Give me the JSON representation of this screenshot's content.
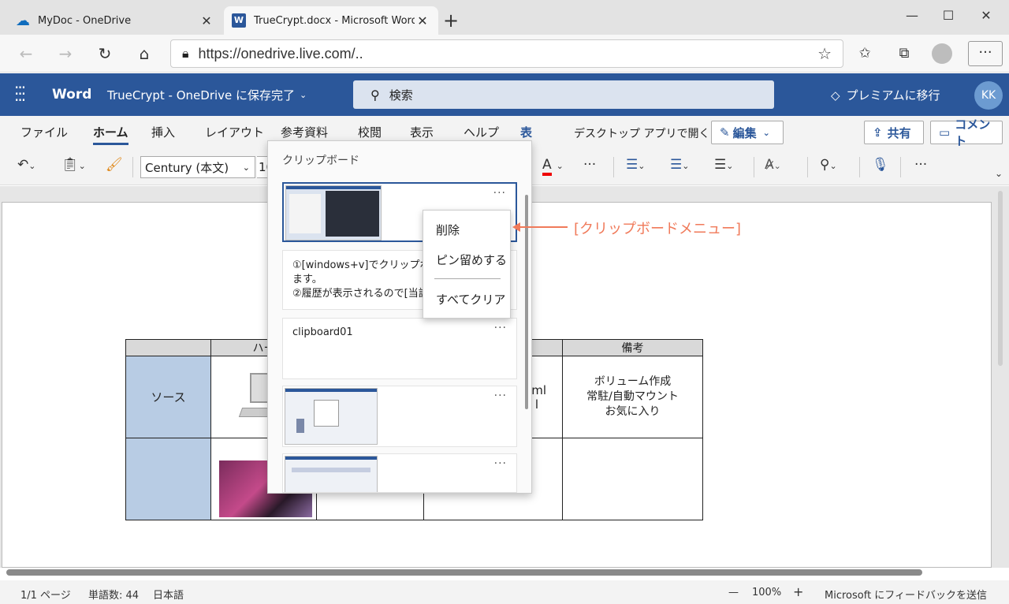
{
  "browser": {
    "tabs": [
      {
        "title": "MyDoc - OneDrive",
        "icon": "onedrive-cloud-icon"
      },
      {
        "title": "TrueCrypt.docx - Microsoft Word",
        "icon": "word-icon"
      }
    ],
    "new_tab": "+",
    "url": "https://onedrive.live.com/..",
    "window_controls": [
      "—",
      "☐",
      "✕"
    ]
  },
  "word_header": {
    "app_name": "Word",
    "doc_title": "TrueCrypt - OneDrive に保存完了",
    "search_placeholder": "検索",
    "premium": "プレミアムに移行",
    "avatar_initials": "KK",
    "brand_color": "#2b579a"
  },
  "ribbon": {
    "tabs": [
      "ファイル",
      "ホーム",
      "挿入",
      "レイアウト",
      "参考資料",
      "校閲",
      "表示",
      "ヘルプ",
      "表"
    ],
    "active_tab": "ホーム",
    "desktop_app": "デスクトップ アプリで開く",
    "edit_button": "編集",
    "share_button": "共有",
    "comment_button": "コメント"
  },
  "toolbar": {
    "font_name": "Century (本文)",
    "font_size": "10",
    "font_color_icon": "A"
  },
  "document": {
    "table_headers": [
      "",
      "ハー",
      "",
      "",
      "備考"
    ],
    "row1": {
      "label": "ソース",
      "text_frag_1": "ml",
      "text_frag_2": "l",
      "remarks": [
        "ボリューム作成",
        "常駐/自動マウント",
        "お気に入り"
      ]
    },
    "row2": {
      "label": ""
    }
  },
  "clipboard_pane": {
    "title": "クリップボード",
    "items": [
      {
        "type": "image",
        "more": "···"
      },
      {
        "type": "text",
        "lines": [
          "①[windows+v]でクリップボー",
          "ます。",
          "②履歴が表示されるので[当該"
        ]
      },
      {
        "type": "text",
        "lines": [
          "clipboard01"
        ],
        "more": "···"
      },
      {
        "type": "image",
        "more": "···"
      },
      {
        "type": "image",
        "more": "···"
      }
    ]
  },
  "context_menu": {
    "items": [
      "削除",
      "ピン留めする",
      "すべてクリア"
    ]
  },
  "annotation": {
    "text": "[クリップボードメニュー]",
    "color": "#f07a5a"
  },
  "statusbar": {
    "page": "1/1 ページ",
    "words": "単語数: 44",
    "language": "日本語",
    "zoom": "100%",
    "zoom_out": "—",
    "zoom_in": "+",
    "feedback": "Microsoft にフィードバックを送信"
  }
}
